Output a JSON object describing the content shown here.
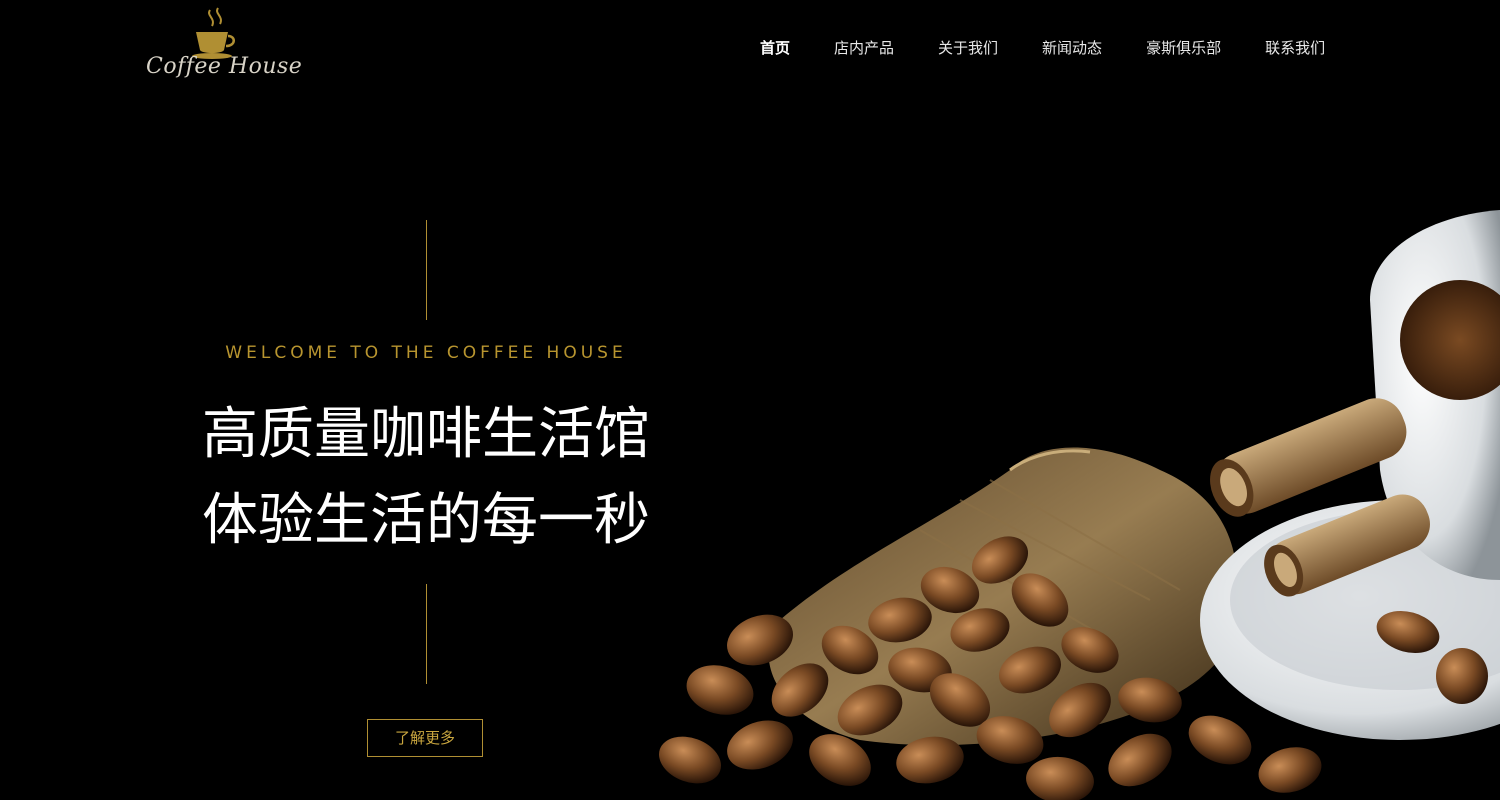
{
  "logo": {
    "text": "Coffee House"
  },
  "nav": {
    "items": [
      {
        "label": "首页",
        "active": true
      },
      {
        "label": "店内产品"
      },
      {
        "label": "关于我们"
      },
      {
        "label": "新闻动态"
      },
      {
        "label": "豪斯俱乐部"
      },
      {
        "label": "联系我们"
      }
    ]
  },
  "hero": {
    "welcome": "WELCOME TO THE COFFEE HOUSE",
    "headline_line1": "高质量咖啡生活馆",
    "headline_line2": "体验生活的每一秒",
    "button_label": "了解更多"
  },
  "colors": {
    "accent": "#b08f33",
    "background": "#000000",
    "text": "#ffffff"
  },
  "icons": {
    "logo": "coffee-cup-icon"
  }
}
